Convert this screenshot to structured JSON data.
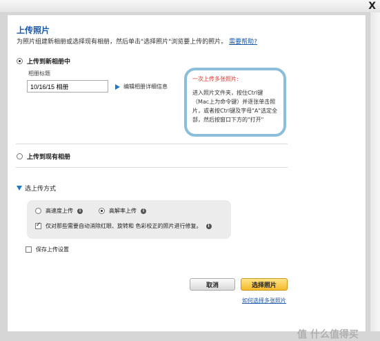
{
  "window": {
    "close_label": "X"
  },
  "dialog": {
    "title": "上传照片",
    "description": "为照片组建新相册或选择现有相册，然后单击\"选择照片\"浏览要上传的照片。",
    "help_link": "需要帮助?"
  },
  "new_album": {
    "radio_label": "上传到新相册中",
    "field_label": "相册标题",
    "field_value": "10/16/15 相册",
    "edit_details": "编辑相册详细信息"
  },
  "tip": {
    "title": "一次上传多张照片:",
    "body": "进入照片文件夹，按住Ctrl键（Mac上为命令键）并逐张单击照片，或者按Ctrl键及字母\"A\"选定全部，然后按窗口下方的\"打开\""
  },
  "existing_album": {
    "radio_label": "上传到现有相册"
  },
  "upload_method": {
    "heading": "选上传方式",
    "fast_label": "高速度上传",
    "quality_label": "高解率上传",
    "selected": "quality",
    "fix_label": "仅对那些需要自动消除红眼、旋转和 色彩校正的照片进行修复。",
    "fix_checked": true
  },
  "save_settings": {
    "label": "保存上传设置",
    "checked": false
  },
  "buttons": {
    "cancel": "取消",
    "select": "选择照片"
  },
  "footer_link": "如何选择多张照片",
  "watermark": "值 什么值得买",
  "colors": {
    "accent": "#1d57a3",
    "select_button": "#f4b929",
    "tip_border": "#8bbfd9",
    "tip_title": "#d9352c"
  }
}
